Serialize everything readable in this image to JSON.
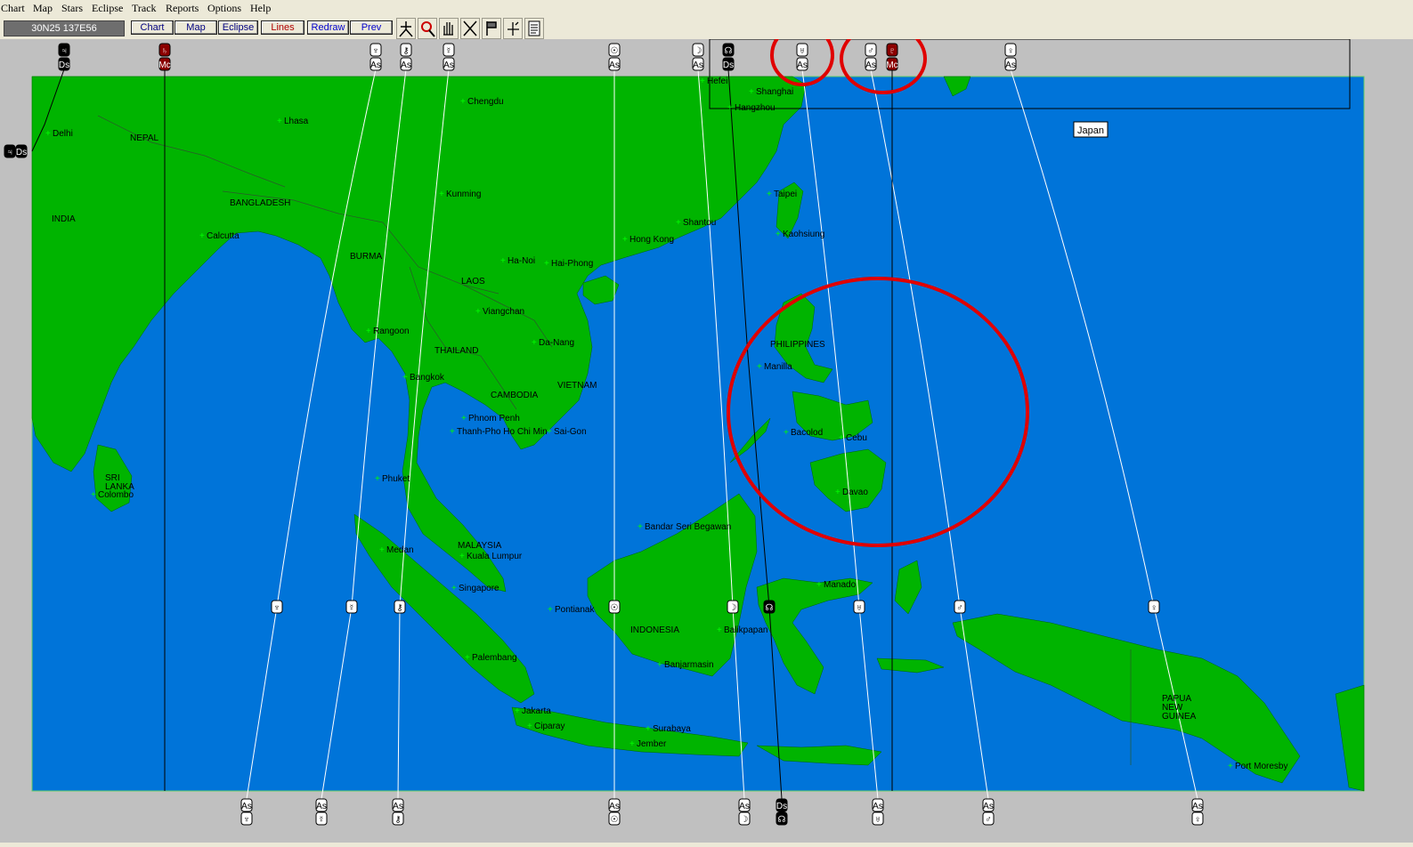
{
  "menu": [
    "Chart",
    "Map",
    "Stars",
    "Eclipse",
    "Track",
    "Reports",
    "Options",
    "Help"
  ],
  "coord": "30N25  137E56",
  "toolbar_buttons": [
    "Chart",
    "Map",
    "Eclipse",
    "Lines",
    "Redraw",
    "Prev"
  ],
  "colors": {
    "ocean": "#0074d9",
    "land": "#00b400",
    "label_bg": "#ffffff",
    "highlight": "#e00000"
  },
  "toolbar_icons": [
    "person-icon",
    "zoom-icon",
    "hand-icon",
    "cross-lines-icon",
    "flag-icon",
    "axis-icon",
    "report-icon"
  ],
  "map_labels": {
    "cities": [
      "Delhi",
      "Lhasa",
      "Chengdu",
      "Kunming",
      "Calcutta",
      "Rangoon",
      "Bangkok",
      "Ha-Noi",
      "Hai-Phong",
      "Viangchan",
      "Da-Nang",
      "Phnom Penh",
      "Thanh-Pho Ho Chi Min",
      "Sai-Gon",
      "Phuket",
      "Medan",
      "Kuala Lumpur",
      "Singapore",
      "Palembang",
      "Jakarta",
      "Ciparay",
      "Surabaya",
      "Jember",
      "Pontianak",
      "Banjarmasin",
      "Balikpapan",
      "Bandar Seri Begawan",
      "Manado",
      "Davao",
      "Cebu",
      "Bacolod",
      "Manilla",
      "Kaohsiung",
      "Taipei",
      "Shantou",
      "Hong Kong",
      "Shanghai",
      "Hangzhou",
      "Hefei",
      "Port Moresby",
      "Colombo"
    ],
    "countries": [
      "NEPAL",
      "INDIA",
      "BANGLADESH",
      "BURMA",
      "LAOS",
      "THAILAND",
      "CAMBODIA",
      "VIETNAM",
      "MALAYSIA",
      "INDONESIA",
      "PHILIPPINES",
      "SRI LANKA",
      "PAPUA NEW GUINEA"
    ],
    "boxed": "Japan"
  },
  "planet_lines": {
    "top": [
      {
        "glyph": "♃",
        "angle": "Ds"
      },
      {
        "glyph": "♄",
        "angle": "Mc"
      },
      {
        "glyph": "♆",
        "angle": "As"
      },
      {
        "glyph": "⚷",
        "angle": "As"
      },
      {
        "glyph": "☿",
        "angle": "As"
      },
      {
        "glyph": "☉",
        "angle": "As"
      },
      {
        "glyph": "☽",
        "angle": "As"
      },
      {
        "glyph": "☊",
        "angle": "Ds"
      },
      {
        "glyph": "♅",
        "angle": "As"
      },
      {
        "glyph": "♂",
        "angle": "As"
      },
      {
        "glyph": "♇",
        "angle": "Mc"
      },
      {
        "glyph": "♀",
        "angle": "As"
      }
    ],
    "middle": [
      "♆",
      "☿",
      "⚷",
      "☉",
      "☽",
      "☊",
      "♅",
      "♂",
      "♀"
    ],
    "bottom": [
      {
        "glyph": "♆",
        "angle": "As"
      },
      {
        "glyph": "☿",
        "angle": "As"
      },
      {
        "glyph": "⚷",
        "angle": "As"
      },
      {
        "glyph": "☉",
        "angle": "As"
      },
      {
        "glyph": "☽",
        "angle": "As"
      },
      {
        "glyph": "☊",
        "angle": "Ds"
      },
      {
        "glyph": "♅",
        "angle": "As"
      },
      {
        "glyph": "♂",
        "angle": "As"
      },
      {
        "glyph": "♀",
        "angle": "As"
      }
    ],
    "left_marker": {
      "glyph": "♃",
      "angle": "Ds"
    }
  }
}
